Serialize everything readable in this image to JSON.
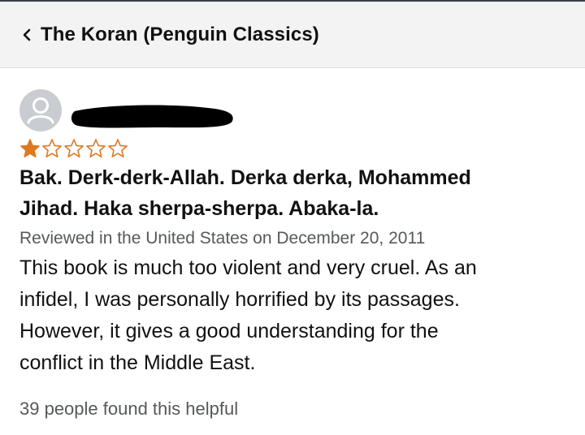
{
  "header": {
    "back_icon": "chevron-left-icon",
    "title": "The Koran (Penguin Classics)"
  },
  "review": {
    "reviewer_name": "",
    "avatar_icon": "default-user-avatar-icon",
    "rating": 1,
    "rating_max": 5,
    "star_color": "#de7921",
    "title_line1": "Bak. Derk-derk-Allah. Derka derka, Mohammed",
    "title_line2": "Jihad. Haka sherpa-sherpa. Abaka-la.",
    "meta": "Reviewed in the United States on December 20, 2011",
    "body_lines": [
      "This book is much too violent and very cruel. As an",
      "infidel, I was personally horrified by its passages.",
      "However, it gives a good understanding for the",
      "conflict in the Middle East."
    ],
    "helpful_text": "39 people found this helpful"
  }
}
